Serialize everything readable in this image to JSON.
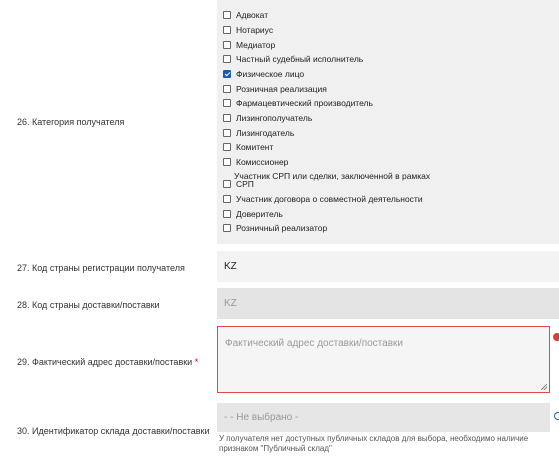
{
  "rows": {
    "r26": {
      "label": "26. Категория получателя"
    },
    "r27": {
      "label": "27. Код страны регистрации получателя",
      "value": "KZ"
    },
    "r28": {
      "label": "28. Код страны доставки/поставки",
      "value": "KZ"
    },
    "r29": {
      "label": "29. Фактический адрес доставки/поставки",
      "required_mark": "*",
      "placeholder": "Фактический адрес доставки/поставки"
    },
    "r30": {
      "label": "30. Идентификатор склада доставки/поставки",
      "select_value": "- - Не выбрано -",
      "hint_line1": "У получателя нет доступных публичных складов для выбора, необходимо наличие",
      "hint_line2": "признаком \"Публичный склад\""
    }
  },
  "categories": [
    {
      "label": "Адвокат",
      "checked": false
    },
    {
      "label": "Нотариус",
      "checked": false
    },
    {
      "label": "Медиатор",
      "checked": false
    },
    {
      "label": "Частный судебный исполнитель",
      "checked": false
    },
    {
      "label": "Физическое лицо",
      "checked": true
    },
    {
      "label": "Розничная реализация",
      "checked": false
    },
    {
      "label": "Фармацевтический производитель",
      "checked": false
    },
    {
      "label": "Лизингополучатель",
      "checked": false
    },
    {
      "label": "Лизингодатель",
      "checked": false
    },
    {
      "label": "Комитент",
      "checked": false
    },
    {
      "label": "Комиссионер",
      "checked": false
    },
    {
      "label": "Участник СРП или сделки, заключенной в рамках",
      "label2": "СРП",
      "checked": false
    },
    {
      "label": "Участник договора о совместной деятельности",
      "checked": false
    },
    {
      "label": "Доверитель",
      "checked": false
    },
    {
      "label": "Розничный реализатор",
      "checked": false
    }
  ]
}
